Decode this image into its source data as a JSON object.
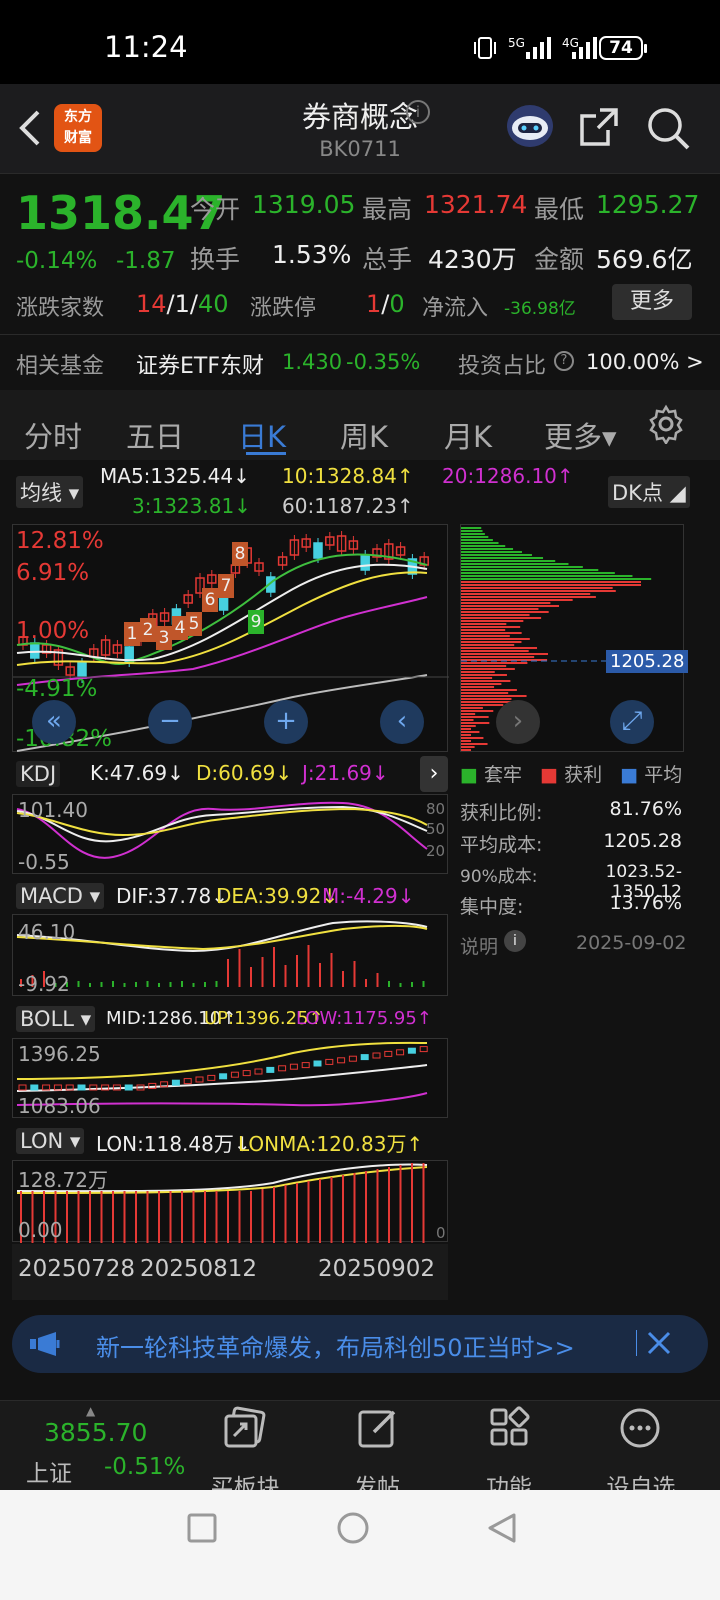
{
  "status": {
    "time": "11:24",
    "net1": "5G",
    "net2": "4G",
    "battery": "74"
  },
  "header": {
    "logo_line1": "东方",
    "logo_line2": "财富",
    "title": "券商概念",
    "code": "BK0711"
  },
  "quote": {
    "price": "1318.47",
    "pct": "-0.14%",
    "chg": "-1.87",
    "open_label": "今开",
    "open": "1319.05",
    "high_label": "最高",
    "high": "1321.74",
    "low_label": "最低",
    "low": "1295.27",
    "turnover_label": "换手",
    "turnover": "1.53%",
    "vol_label": "总手",
    "vol": "4230万",
    "amount_label": "金额",
    "amount": "569.6亿",
    "breadth_label": "涨跌家数",
    "breadth_up": "14",
    "breadth_flat": "1",
    "breadth_down": "40",
    "slash": "/",
    "limit_label": "涨跌停",
    "limit_up": "1",
    "limit_down": "0",
    "flow_label": "净流入",
    "flow": "-36.98亿",
    "more": "更多"
  },
  "fund": {
    "label": "相关基金",
    "name": "证券ETF东财",
    "price": "1.430",
    "pct": "-0.35%",
    "ratio_label": "投资占比",
    "ratio": "100.00% >"
  },
  "tabs": [
    "分时",
    "五日",
    "日K",
    "周K",
    "月K",
    "更多▾"
  ],
  "ma": {
    "dropdown": "均线",
    "ma5": "MA5:1325.44↓",
    "ma10": "10:1328.84↑",
    "ma20": "20:1286.10↑",
    "ma3": "3:1323.81↓",
    "ma60": "60:1187.23↑",
    "dk": "DK点"
  },
  "main_axis": {
    "a": "12.81%",
    "b": "6.91%",
    "c": "1.00%",
    "d": "-4.91%",
    "e": "-10.82%"
  },
  "candle_labels": [
    "1",
    "2",
    "3",
    "4",
    "5",
    "6",
    "7",
    "8",
    "9"
  ],
  "kdj": {
    "name": "KDJ",
    "k": "K:47.69↓",
    "d": "D:60.69↓",
    "j": "J:21.69↓",
    "top": "101.40",
    "bottom": "-0.55",
    "r80": "80",
    "r50": "50",
    "r20": "20"
  },
  "macd": {
    "name": "MACD",
    "dif": "DIF:37.78↓",
    "dea": "DEA:39.92↓",
    "m": "M:-4.29↓",
    "top": "46.10",
    "bottom": "-9.92"
  },
  "boll": {
    "name": "BOLL",
    "mid": "MID:1286.10↑",
    "up": "UP:1396.25↑",
    "low": "LOW:1175.95↑",
    "top": "1396.25",
    "bottom": "1083.06"
  },
  "lon": {
    "name": "LON",
    "lon": "LON:118.48万↓",
    "lonma": "LONMA:120.83万↑",
    "top": "128.72万",
    "bottom": "0.00",
    "r0": "0"
  },
  "dates": [
    "20250728",
    "20250812",
    "20250902"
  ],
  "chip": {
    "price_tag": "1205.28",
    "legend": [
      "套牢",
      "获利",
      "平均"
    ],
    "rows": [
      {
        "label": "获利比例:",
        "value": "81.76%"
      },
      {
        "label": "平均成本:",
        "value": "1205.28"
      },
      {
        "label": "90%成本:",
        "value": "1023.52-1350.12"
      },
      {
        "label": "集中度:",
        "value": "13.76%"
      }
    ],
    "note": "说明",
    "date": "2025-09-02"
  },
  "banner": {
    "text": "新一轮科技革命爆发，布局科创50正当时>>"
  },
  "bottom": {
    "index_value": "3855.70",
    "index_name": "上证",
    "index_pct": "-0.51%",
    "items": [
      "买板块",
      "发帖",
      "功能",
      "设自选"
    ]
  },
  "colors": {
    "up": "#e53935",
    "down": "#2bb32b",
    "accent": "#3a7bd5",
    "bg": "#121212"
  }
}
